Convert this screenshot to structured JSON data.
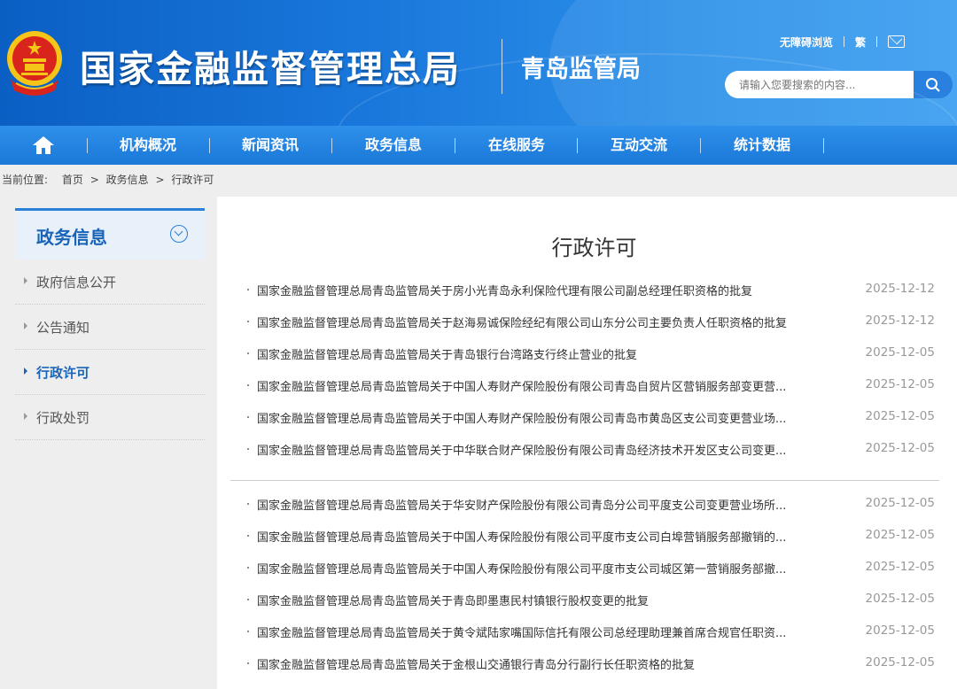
{
  "header": {
    "org_name": "国家金融监督管理总局",
    "bureau_name": "青岛监管局",
    "util_accessible": "无障碍浏览",
    "util_traditional": "繁",
    "search_placeholder": "请输入您要搜索的内容..."
  },
  "nav": {
    "items": [
      "机构概况",
      "新闻资讯",
      "政务信息",
      "在线服务",
      "互动交流",
      "统计数据"
    ]
  },
  "breadcrumb": {
    "prefix": "当前位置:",
    "home": "首页",
    "sep": ">",
    "section": "政务信息",
    "current": "行政许可"
  },
  "sidebar": {
    "title": "政务信息",
    "items": [
      "政府信息公开",
      "公告通知",
      "行政许可",
      "行政处罚"
    ],
    "active_index": 2
  },
  "main": {
    "title": "行政许可",
    "group1": [
      {
        "title": "国家金融监督管理总局青岛监管局关于房小光青岛永利保险代理有限公司副总经理任职资格的批复",
        "date": "2025-12-12"
      },
      {
        "title": "国家金融监督管理总局青岛监管局关于赵海易诚保险经纪有限公司山东分公司主要负责人任职资格的批复",
        "date": "2025-12-12"
      },
      {
        "title": "国家金融监督管理总局青岛监管局关于青岛银行台湾路支行终止营业的批复",
        "date": "2025-12-05"
      },
      {
        "title": "国家金融监督管理总局青岛监管局关于中国人寿财产保险股份有限公司青岛自贸片区营销服务部变更营...",
        "date": "2025-12-05"
      },
      {
        "title": "国家金融监督管理总局青岛监管局关于中国人寿财产保险股份有限公司青岛市黄岛区支公司变更营业场...",
        "date": "2025-12-05"
      },
      {
        "title": "国家金融监督管理总局青岛监管局关于中华联合财产保险股份有限公司青岛经济技术开发区支公司变更...",
        "date": "2025-12-05"
      }
    ],
    "group2": [
      {
        "title": "国家金融监督管理总局青岛监管局关于华安财产保险股份有限公司青岛分公司平度支公司变更营业场所...",
        "date": "2025-12-05"
      },
      {
        "title": "国家金融监督管理总局青岛监管局关于中国人寿保险股份有限公司平度市支公司白埠营销服务部撤销的...",
        "date": "2025-12-05"
      },
      {
        "title": "国家金融监督管理总局青岛监管局关于中国人寿保险股份有限公司平度市支公司城区第一营销服务部撤...",
        "date": "2025-12-05"
      },
      {
        "title": "国家金融监督管理总局青岛监管局关于青岛即墨惠民村镇银行股权变更的批复",
        "date": "2025-12-05"
      },
      {
        "title": "国家金融监督管理总局青岛监管局关于黄令斌陆家嘴国际信托有限公司总经理助理兼首席合规官任职资...",
        "date": "2025-12-05"
      },
      {
        "title": "国家金融监督管理总局青岛监管局关于金根山交通银行青岛分行副行长任职资格的批复",
        "date": "2025-12-05"
      }
    ]
  }
}
